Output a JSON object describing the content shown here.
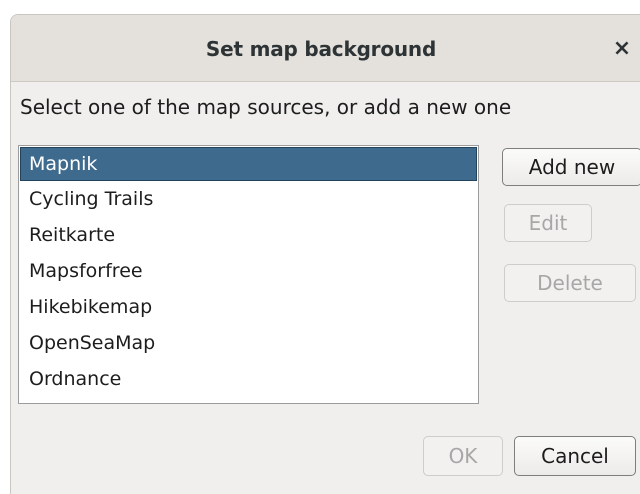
{
  "window": {
    "title": "Set map background",
    "close_glyph": "×"
  },
  "instruction": "Select one of the map sources, or add a new one",
  "map_sources": {
    "selected_index": 0,
    "items": [
      "Mapnik",
      "Cycling Trails",
      "Reitkarte",
      "Mapsforfree",
      "Hikebikemap",
      "OpenSeaMap",
      "Ordnance"
    ]
  },
  "side_buttons": {
    "add_new": "Add new",
    "edit": "Edit",
    "delete": "Delete"
  },
  "footer_buttons": {
    "ok": "OK",
    "cancel": "Cancel"
  },
  "colors": {
    "selection": "#3e6a8e",
    "disabled_text": "#a7a7a7"
  }
}
